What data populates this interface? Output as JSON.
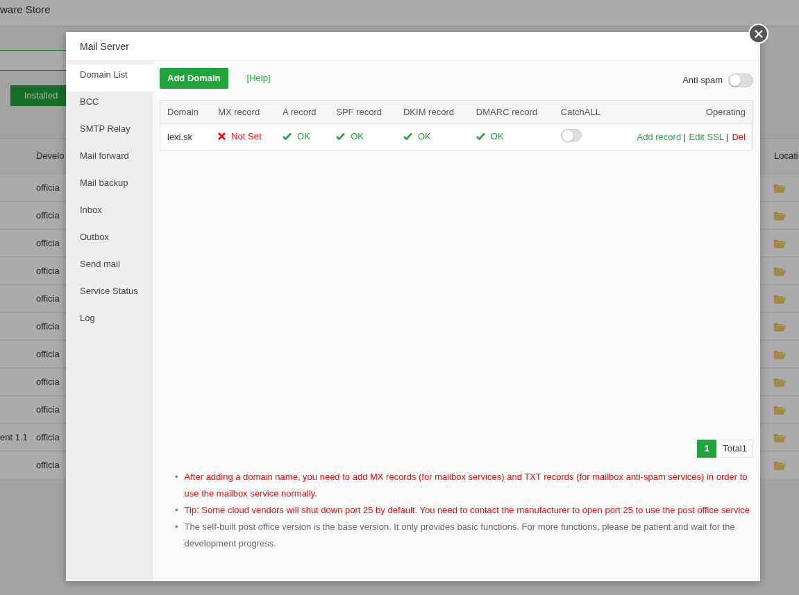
{
  "background": {
    "title": "ware Store",
    "installed_button": "Installed",
    "table": {
      "columns": [
        "Develo",
        "Locati"
      ],
      "rows": [
        {
          "developer": "officia"
        },
        {
          "developer": "officia"
        },
        {
          "developer": "officia"
        },
        {
          "developer": "officia"
        },
        {
          "developer": "officia"
        },
        {
          "developer": "officia"
        },
        {
          "developer": "officia"
        },
        {
          "developer": "officia"
        },
        {
          "developer": "officia"
        },
        {
          "column_1": "ent 1.1",
          "developer": "officia"
        },
        {
          "developer": "officia"
        }
      ]
    }
  },
  "modal": {
    "title": "Mail Server",
    "sidebar": {
      "items": [
        {
          "label": "Domain List",
          "selected": true
        },
        {
          "label": "BCC",
          "selected": false
        },
        {
          "label": "SMTP Relay",
          "selected": false
        },
        {
          "label": "Mail forward",
          "selected": false
        },
        {
          "label": "Mail backup",
          "selected": false
        },
        {
          "label": "Inbox",
          "selected": false
        },
        {
          "label": "Outbox",
          "selected": false
        },
        {
          "label": "Send mail",
          "selected": false
        },
        {
          "label": "Service Status",
          "selected": false
        },
        {
          "label": "Log",
          "selected": false
        }
      ]
    },
    "add_button": "Add Domain",
    "help_link": "[Help]",
    "anti_spam": {
      "label": "Anti spam",
      "on": false
    },
    "table": {
      "columns": [
        "Domain",
        "MX record",
        "A record",
        "SPF record",
        "DKIM record",
        "DMARC record",
        "CatchALL",
        "Operating"
      ],
      "rows": [
        {
          "domain": "lexi.sk",
          "records": [
            {
              "ok": false,
              "text": "Not Set"
            },
            {
              "ok": true,
              "text": "OK"
            },
            {
              "ok": true,
              "text": "OK"
            },
            {
              "ok": true,
              "text": "OK"
            },
            {
              "ok": true,
              "text": "OK"
            }
          ],
          "catchall": {
            "on": false
          },
          "actions": [
            {
              "label": "Add record",
              "kind": "normal",
              "separator": "|"
            },
            {
              "label": "Edit SSL",
              "kind": "normal",
              "separator": "|"
            },
            {
              "label": "Del",
              "kind": "danger"
            }
          ]
        }
      ]
    },
    "pagination": {
      "pages": [
        {
          "label": "1",
          "selected": true
        }
      ],
      "total": "Total1"
    },
    "notes": [
      {
        "kind": "warning",
        "bullet": "•",
        "text": "After adding a domain name, you need to add MX records (for mailbox services) and TXT records (for mailbox anti-spam services) in order to use the mailbox service normally."
      },
      {
        "kind": "warning",
        "bullet": "•",
        "text": "Tip: Some cloud vendors will shut down port 25 by default. You need to contact the manufacturer to open port 25 to use the post office service"
      },
      {
        "kind": "info",
        "bullet": "•",
        "text": "The self-built post office version is the base version. It only provides basic functions. For more functions, please be patient and wait for the development progress."
      }
    ]
  }
}
